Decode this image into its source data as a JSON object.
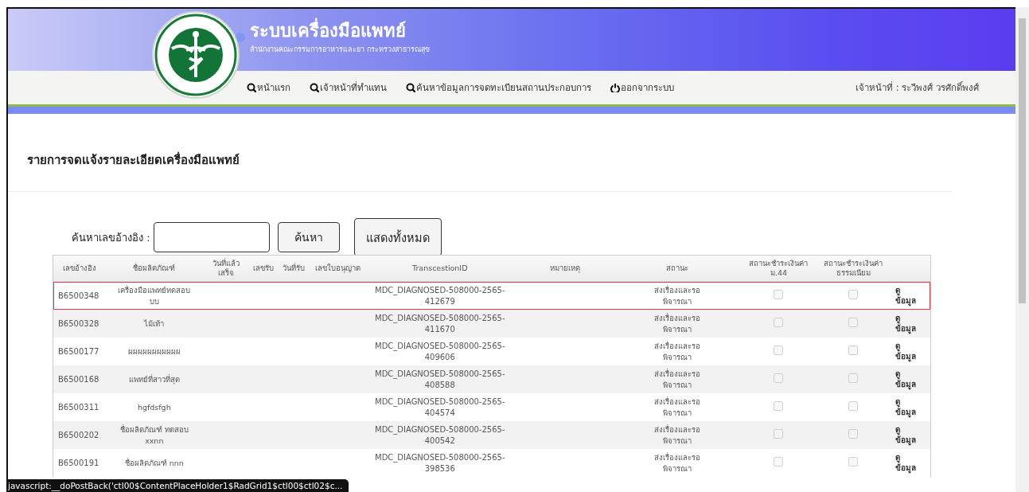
{
  "header": {
    "title": "ระบบเครื่องมือแพทย์",
    "subtitle": "สำนักงานคณะกรรมการอาหารและยา กระทรวงสาธารณสุข"
  },
  "nav": {
    "items": [
      {
        "label": "หน้าแรก",
        "kind": "search"
      },
      {
        "label": "เจ้าหน้าที่ทำแทน",
        "kind": "search"
      },
      {
        "label": "ค้นหาข้อมูลการจดทะเบียนสถานประกอบการ",
        "kind": "search"
      },
      {
        "label": "ออกจากระบบ",
        "kind": "power"
      }
    ],
    "user": "เจ้าหน้าที่ : ระวีพงศ์ วรศักดิ์พงศ์"
  },
  "heading": "รายการจดแจ้งรายละเอียดเครื่องมือแพทย์",
  "search": {
    "label": "ค้นหาเลขอ้างอิง :",
    "buttons": [
      "ค้นหา",
      "แสดงทั้งหมด"
    ]
  },
  "table": {
    "columns": [
      "เลขอ้างอิง",
      "ชื่อผลิตภัณฑ์",
      "วันที่แล้วเสร็จ",
      "เลขรับ",
      "วันที่รับ",
      "เลขใบอนุญาต",
      "TranscestionID",
      "หมายเหตุ",
      "สถานะ",
      "สถานะชำระเงินค่า ม.44",
      "สถานะชำระเงินค่าธรรมเนียม"
    ],
    "rows": [
      {
        "ref": "B6500348",
        "product": "เครื่องมือแพทย์ทดสอบบบ",
        "transaction_id": "MDC_DIAGNOSED-508000-2565-412679",
        "status": "ส่งเรื่องและรอพิจารณา",
        "paid_m44": false,
        "paid_fee": false,
        "action": "ดู ข้อมูล",
        "selected": true
      },
      {
        "ref": "B6500328",
        "product": "ไม้เท้า",
        "transaction_id": "MDC_DIAGNOSED-508000-2565-411670",
        "status": "ส่งเรื่องและรอพิจารณา",
        "paid_m44": false,
        "paid_fee": false,
        "action": "ดู ข้อมูล",
        "selected": false
      },
      {
        "ref": "B6500177",
        "product": "ผผผผผผผผผผผ",
        "transaction_id": "MDC_DIAGNOSED-508000-2565-409606",
        "status": "ส่งเรื่องและรอพิจารณา",
        "paid_m44": false,
        "paid_fee": false,
        "action": "ดู ข้อมูล",
        "selected": false
      },
      {
        "ref": "B6500168",
        "product": "แพทย์ที่สาวที่สุด",
        "transaction_id": "MDC_DIAGNOSED-508000-2565-408588",
        "status": "ส่งเรื่องและรอพิจารณา",
        "paid_m44": false,
        "paid_fee": false,
        "action": "ดู ข้อมูล",
        "selected": false
      },
      {
        "ref": "B6500311",
        "product": "hgfdsfgh",
        "transaction_id": "MDC_DIAGNOSED-508000-2565-404574",
        "status": "ส่งเรื่องและรอพิจารณา",
        "paid_m44": false,
        "paid_fee": false,
        "action": "ดู ข้อมูล",
        "selected": false
      },
      {
        "ref": "B6500202",
        "product": "ชื่อผลิตภัณฑ์ ทดสอบ xxnn",
        "transaction_id": "MDC_DIAGNOSED-508000-2565-400542",
        "status": "ส่งเรื่องและรอพิจารณา",
        "paid_m44": false,
        "paid_fee": false,
        "action": "ดู ข้อมูล",
        "selected": false
      },
      {
        "ref": "B6500191",
        "product": "ชื่อผลิตภัณฑ์ nnn",
        "transaction_id": "MDC_DIAGNOSED-508000-2565-398536",
        "status": "ส่งเรื่องและรอพิจารณา",
        "paid_m44": false,
        "paid_fee": false,
        "action": "ดู ข้อมูล",
        "selected": false
      }
    ]
  },
  "status_bar": "javascript:__doPostBack('ctl00$ContentPlaceHolder1$RadGrid1$ctl00$ctl02$c..."
}
